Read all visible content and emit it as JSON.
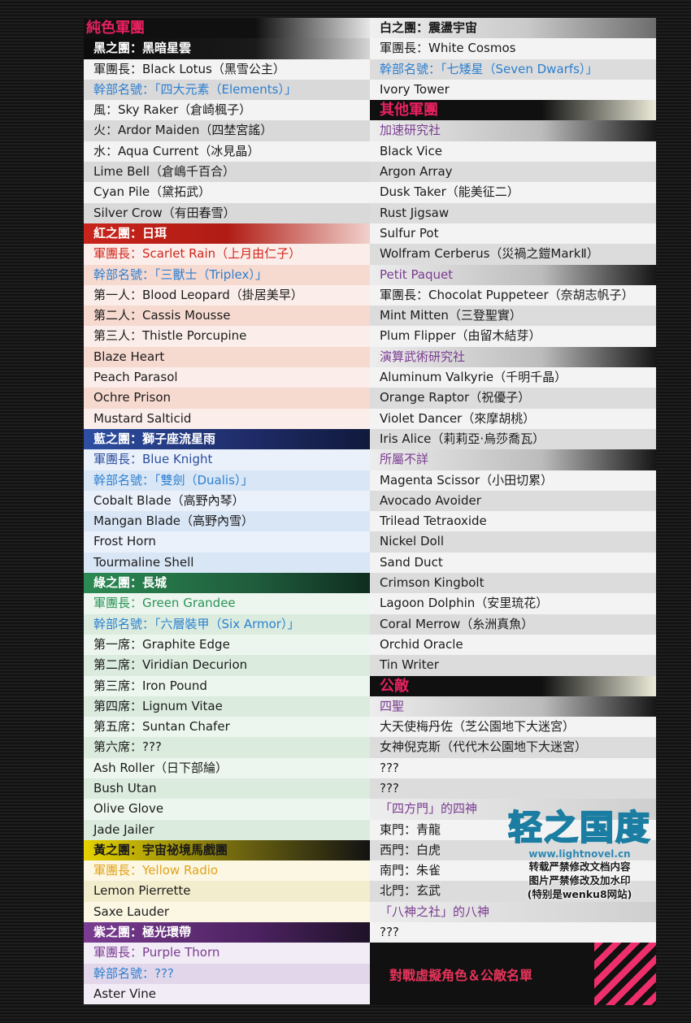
{
  "left_column": [
    {
      "text": "純色軍團",
      "style": "big",
      "fg": "#e6215f",
      "bg": "linear-gradient(90deg,#101010 0%,#101010 60%,#e7e7e7 100%)"
    },
    {
      "text": "黑之團：黑暗星雲",
      "style": "hdr",
      "bg": "linear-gradient(90deg,#0c0c0c 0%,#1a1a1a 60%,#d6d6d6 100%)"
    },
    {
      "text": "軍團長：Black Lotus（黑雪公主）",
      "bg": "#f3f3f3"
    },
    {
      "text": "幹部名號：「四大元素（Elements）」",
      "fg": "#2d7fcf",
      "bg": "#d9d9d9"
    },
    {
      "text": "風：Sky Raker（倉崎楓子）",
      "bg": "#f3f3f3"
    },
    {
      "text": "火：Ardor Maiden（四埜宮謠）",
      "bg": "#d9d9d9"
    },
    {
      "text": "水：Aqua Current（冰見晶）",
      "bg": "#f3f3f3"
    },
    {
      "text": "Lime Bell（倉嶋千百合）",
      "bg": "#d9d9d9"
    },
    {
      "text": "Cyan Pile（黛拓武）",
      "bg": "#f3f3f3"
    },
    {
      "text": "Silver Crow（有田春雪）",
      "bg": "#d9d9d9"
    },
    {
      "text": "紅之團：日珥",
      "style": "hdr",
      "bg": "linear-gradient(90deg,#c8241b 0%,#b01c14 50%,#f1d1cc 100%)"
    },
    {
      "text": "軍團長：Scarlet Rain（上月由仁子）",
      "fg": "#d0261d",
      "bg": "#fbeeea"
    },
    {
      "text": "幹部名號：「三獸士（Triplex）」",
      "fg": "#2d7fcf",
      "bg": "#f6d9cf"
    },
    {
      "text": "第一人：Blood Leopard（掛居美早）",
      "bg": "#fbeeea"
    },
    {
      "text": "第二人：Cassis Mousse",
      "bg": "#f6d9cf"
    },
    {
      "text": "第三人：Thistle Porcupine",
      "bg": "#fbeeea"
    },
    {
      "text": "Blaze Heart",
      "bg": "#f6d9cf"
    },
    {
      "text": "Peach Parasol",
      "bg": "#fbeeea"
    },
    {
      "text": "Ochre Prison",
      "bg": "#f6d9cf"
    },
    {
      "text": "Mustard Salticid",
      "bg": "#fbeeea"
    },
    {
      "text": "藍之團：獅子座流星雨",
      "style": "hdr",
      "bg": "linear-gradient(90deg,#2d4fa2 0%,#1e2a66 60%,#101a3c 100%)"
    },
    {
      "text": "軍團長：Blue Knight",
      "fg": "#2b4d9e",
      "bg": "#eaf1fb"
    },
    {
      "text": "幹部名號：「雙劍（Dualis）」",
      "fg": "#2d7fcf",
      "bg": "#d9e6f6"
    },
    {
      "text": "Cobalt Blade（高野內琴）",
      "bg": "#eaf1fb"
    },
    {
      "text": "Mangan Blade（高野內雪）",
      "bg": "#d9e6f6"
    },
    {
      "text": "Frost Horn",
      "bg": "#eaf1fb"
    },
    {
      "text": "Tourmaline Shell",
      "bg": "#d9e6f6"
    },
    {
      "text": "綠之團：長城",
      "style": "hdr",
      "bg": "linear-gradient(90deg,#2b8a53 0%,#1f5c3c 60%,#0f2d1f 100%)"
    },
    {
      "text": "軍團長：Green Grandee",
      "fg": "#2a9457",
      "bg": "#ecf6ee"
    },
    {
      "text": "幹部名號：「六層裝甲（Six Armor）」",
      "fg": "#2d7fcf",
      "bg": "#dbecdf"
    },
    {
      "text": "第一席：Graphite Edge",
      "bg": "#ecf6ee"
    },
    {
      "text": "第二席：Viridian Decurion",
      "bg": "#dbecdf"
    },
    {
      "text": "第三席：Iron Pound",
      "bg": "#ecf6ee"
    },
    {
      "text": "第四席：Lignum Vitae",
      "bg": "#dbecdf"
    },
    {
      "text": "第五席：Suntan Chafer",
      "bg": "#ecf6ee"
    },
    {
      "text": "第六席：???",
      "bg": "#dbecdf"
    },
    {
      "text": "Ash Roller（日下部綸）",
      "bg": "#ecf6ee"
    },
    {
      "text": "Bush Utan",
      "bg": "#dbecdf"
    },
    {
      "text": "Olive Glove",
      "bg": "#ecf6ee"
    },
    {
      "text": "Jade Jailer",
      "bg": "#dbecdf"
    },
    {
      "text": "黃之團：宇宙祕境馬戲團",
      "style": "hdr",
      "fgHdr": "#1a1a1a",
      "bg": "linear-gradient(90deg,#e5d200 0%,#6d6410 55%,#121212 100%)"
    },
    {
      "text": "軍團長：Yellow Radio",
      "fg": "#e3a21a",
      "bg": "#fbf7e3"
    },
    {
      "text": "Lemon Pierrette",
      "bg": "#f2edcc"
    },
    {
      "text": "Saxe Lauder",
      "bg": "#fbf7e3"
    },
    {
      "text": "紫之團：極光環帶",
      "style": "hdr",
      "bg": "linear-gradient(90deg,#7a3c91 0%,#4c2260 60%,#1e1228 100%)"
    },
    {
      "text": "軍團長：Purple Thorn",
      "fg": "#7a3c91",
      "bg": "#f2ecf6"
    },
    {
      "text": "幹部名號：???",
      "fg": "#2d7fcf",
      "bg": "#e2d7ea"
    },
    {
      "text": "Aster Vine",
      "bg": "#f2ecf6"
    }
  ],
  "right_column": [
    {
      "text": "白之團：震盪宇宙",
      "style": "hdr",
      "fgHdr": "#1a1a1a",
      "bg": "linear-gradient(90deg,#f0f0f0 0%,#c9c9c9 55%,#6d6d6d 100%)"
    },
    {
      "text": "軍團長：White Cosmos",
      "bg": "#f3f3f3"
    },
    {
      "text": "幹部名號：「七矮星（Seven Dwarfs）」",
      "fg": "#2d7fcf",
      "bg": "#dcdcdc"
    },
    {
      "text": "Ivory Tower",
      "bg": "#f3f3f3"
    },
    {
      "text": "其他軍團",
      "style": "big",
      "fg": "#e6215f",
      "bg": "linear-gradient(90deg,#101010 0%,#101010 60%,#ecebd9 100%)"
    },
    {
      "text": "加速研究社",
      "fg": "#7a3c91",
      "bg": "linear-gradient(90deg,#ededed 0%,#bcbcbc 60%,#161616 100%)"
    },
    {
      "text": "Black Vice",
      "bg": "#f3f3f3"
    },
    {
      "text": "Argon Array",
      "bg": "#dcdcdc"
    },
    {
      "text": "Dusk Taker（能美征二）",
      "bg": "#f3f3f3"
    },
    {
      "text": "Rust Jigsaw",
      "bg": "#dcdcdc"
    },
    {
      "text": "Sulfur Pot",
      "bg": "#f3f3f3"
    },
    {
      "text": "Wolfram Cerberus（災禍之鎧MarkⅡ）",
      "bg": "#dcdcdc"
    },
    {
      "text": "Petit Paquet",
      "fg": "#7a3c91",
      "bg": "linear-gradient(90deg,#ededed 0%,#bcbcbc 60%,#161616 100%)"
    },
    {
      "text": "軍團長：Chocolat Puppeteer（奈胡志帆子）",
      "bg": "#f3f3f3"
    },
    {
      "text": "Mint Mitten（三登聖實）",
      "bg": "#dcdcdc"
    },
    {
      "text": "Plum Flipper（由留木結芽）",
      "bg": "#f3f3f3"
    },
    {
      "text": "演算武術研究社",
      "fg": "#7a3c91",
      "bg": "linear-gradient(90deg,#ededed 0%,#bcbcbc 60%,#161616 100%)"
    },
    {
      "text": "Aluminum Valkyrie（千明千晶）",
      "bg": "#f3f3f3"
    },
    {
      "text": "Orange Raptor（祝優子）",
      "bg": "#dcdcdc"
    },
    {
      "text": "Violet Dancer（來摩胡桃）",
      "bg": "#f3f3f3"
    },
    {
      "text": "Iris Alice（莉莉亞·烏莎喬瓦）",
      "bg": "#dcdcdc"
    },
    {
      "text": "所屬不詳",
      "fg": "#7a3c91",
      "bg": "linear-gradient(90deg,#ededed 0%,#bcbcbc 60%,#161616 100%)"
    },
    {
      "text": "Magenta Scissor（小田切累）",
      "bg": "#f3f3f3"
    },
    {
      "text": "Avocado Avoider",
      "bg": "#dcdcdc"
    },
    {
      "text": "Trilead Tetraoxide",
      "bg": "#f3f3f3"
    },
    {
      "text": "Nickel Doll",
      "bg": "#dcdcdc"
    },
    {
      "text": "Sand Duct",
      "bg": "#f3f3f3"
    },
    {
      "text": "Crimson Kingbolt",
      "bg": "#dcdcdc"
    },
    {
      "text": "Lagoon Dolphin（安里琉花）",
      "bg": "#f3f3f3"
    },
    {
      "text": "Coral Merrow（糸洲真魚）",
      "bg": "#dcdcdc"
    },
    {
      "text": "Orchid Oracle",
      "bg": "#f3f3f3"
    },
    {
      "text": "Tin Writer",
      "bg": "#dcdcdc"
    },
    {
      "text": "公敵",
      "style": "big",
      "fg": "#e6215f",
      "bg": "linear-gradient(90deg,#101010 0%,#101010 60%,#ecebd9 100%)"
    },
    {
      "text": "四聖",
      "fg": "#7a3c91",
      "bg": "linear-gradient(90deg,#ededed 0%,#bcbcbc 60%,#161616 100%)"
    },
    {
      "text": "大天使梅丹佐（芝公園地下大迷宮）",
      "bg": "#f3f3f3"
    },
    {
      "text": "女神倪克斯（代代木公園地下大迷宮）",
      "bg": "#dcdcdc"
    },
    {
      "text": "???",
      "bg": "#f3f3f3"
    },
    {
      "text": "???",
      "bg": "#dcdcdc"
    },
    {
      "text": "「四方門」的四神",
      "fg": "#7a3c91",
      "bg": "linear-gradient(90deg,#ededed 0%,#cfcfcf 100%)"
    },
    {
      "text": "東門：青龍",
      "bg": "#f3f3f3"
    },
    {
      "text": "西門：白虎",
      "bg": "#dcdcdc"
    },
    {
      "text": "南門：朱雀",
      "bg": "#f3f3f3"
    },
    {
      "text": "北門：玄武",
      "bg": "#dcdcdc"
    },
    {
      "text": "「八神之社」的八神",
      "fg": "#7a3c91",
      "bg": "linear-gradient(90deg,#ededed 0%,#cfcfcf 100%)"
    },
    {
      "text": "???",
      "bg": "#f3f3f3"
    }
  ],
  "footer": {
    "title": "對戰虛擬角色＆公敵名單"
  },
  "watermark": {
    "logo": "轻之国度",
    "url": "www.lightnovel.cn",
    "line1": "转载严禁修改文档内容",
    "line2": "图片严禁修改及加水印",
    "line3": "(特别是wenku8网站)"
  }
}
